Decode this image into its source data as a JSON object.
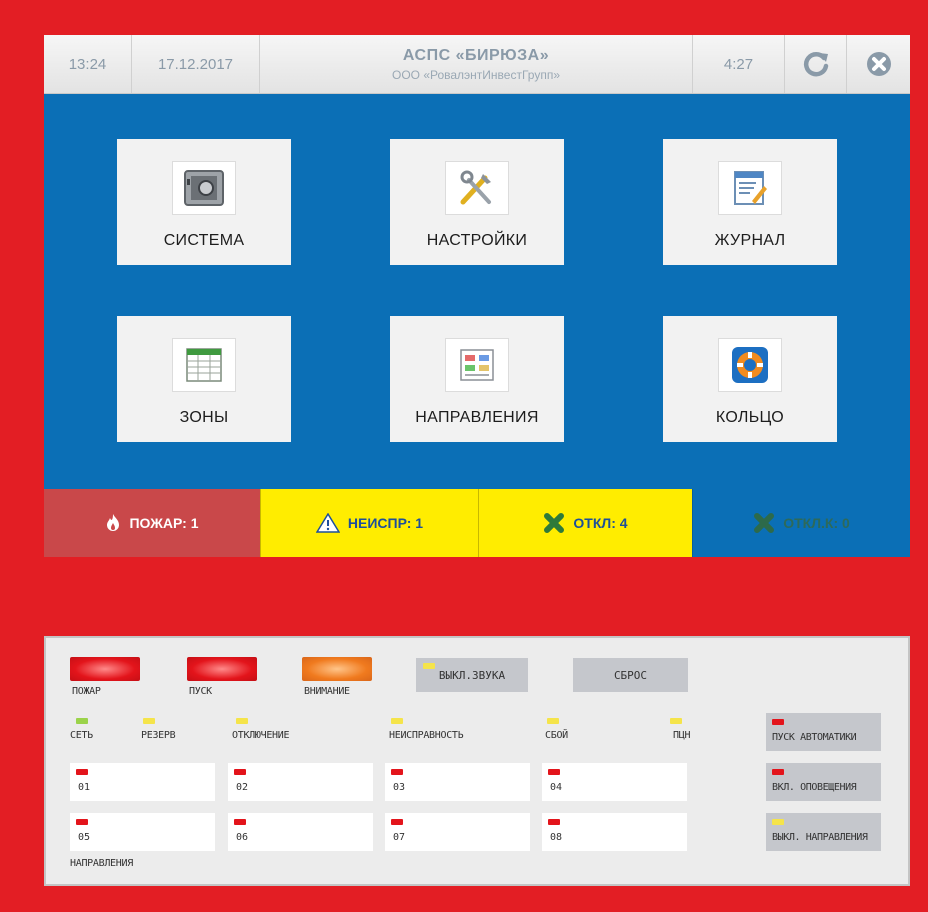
{
  "header": {
    "time": "13:24",
    "date": "17.12.2017",
    "title": "АСПС «БИРЮЗА»",
    "subtitle": "ООО «РовалэнтИнвестГрупп»",
    "timer": "4:27",
    "refresh_icon": "refresh-icon",
    "close_icon": "close-circle-icon"
  },
  "menu": {
    "tiles": [
      {
        "label": "СИСТЕМА",
        "icon": "system-safe-icon"
      },
      {
        "label": "НАСТРОЙКИ",
        "icon": "tools-icon"
      },
      {
        "label": "ЖУРНАЛ",
        "icon": "journal-icon"
      },
      {
        "label": "ЗОНЫ",
        "icon": "table-icon"
      },
      {
        "label": "НАПРАВЛЕНИЯ",
        "icon": "document-icon"
      },
      {
        "label": "КОЛЬЦО",
        "icon": "lifebuoy-icon"
      }
    ]
  },
  "status": {
    "fire": "ПОЖАР: 1",
    "fault": "НЕИСПР: 1",
    "off": "ОТКЛ: 4",
    "off_k": "ОТКЛ.К: 0"
  },
  "panel": {
    "leds": {
      "fire": "ПОЖАР",
      "start": "ПУСК",
      "attention": "ВНИМАНИЕ"
    },
    "buttons": {
      "mute": "ВЫКЛ.ЗВУКА",
      "reset": "СБРОС"
    },
    "indicators": [
      "СЕТЬ",
      "РЕЗЕРВ",
      "ОТКЛЮЧЕНИЕ",
      "НЕИСПРАВНОСТЬ",
      "СБОЙ",
      "ПЦН"
    ],
    "directions": [
      "01",
      "02",
      "03",
      "04",
      "05",
      "06",
      "07",
      "08"
    ],
    "directions_label": "НАПРАВЛЕНИЯ",
    "side": [
      "ПУСК АВТОМАТИКИ",
      "ВКЛ. ОПОВЕЩЕНИЯ",
      "ВЫКЛ. НАПРАВЛЕНИЯ"
    ]
  },
  "colors": {
    "background": "#e31e24",
    "menu": "#0b6fb6",
    "fire_status": "#c9484a",
    "warn_status": "#ffed00",
    "led_red": "#e3141b",
    "led_orange": "#f07a1e",
    "led_yellow": "#f5e44a",
    "led_green": "#9bd34a"
  }
}
